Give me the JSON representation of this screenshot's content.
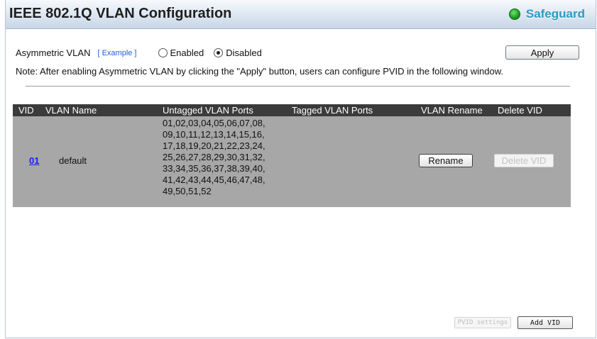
{
  "header": {
    "title": "IEEE 802.1Q VLAN Configuration",
    "safeguard_label": "Safeguard",
    "safeguard_color": "#2b9abf"
  },
  "asymmetric": {
    "label": "Asymmetric VLAN",
    "example_link": "[ Example ]",
    "options": [
      {
        "label": "Enabled",
        "checked": false
      },
      {
        "label": "Disabled",
        "checked": true
      }
    ],
    "apply_label": "Apply"
  },
  "note": "Note: After enabling Asymmetric VLAN by clicking the \"Apply\" button, users can configure PVID in the following window.",
  "table": {
    "columns": [
      "VID",
      "VLAN Name",
      "Untagged VLAN Ports",
      "Tagged VLAN Ports",
      "VLAN Rename",
      "Delete VID"
    ],
    "rows": [
      {
        "vid": "01",
        "name": "default",
        "untagged_lines": [
          "01,02,03,04,05,06,07,08,",
          "09,10,11,12,13,14,15,16,",
          "17,18,19,20,21,22,23,24,",
          "25,26,27,28,29,30,31,32,",
          "33,34,35,36,37,38,39,40,",
          "41,42,43,44,45,46,47,48,",
          "49,50,51,52"
        ],
        "tagged": "",
        "rename_label": "Rename",
        "delete_label": "Delete VID"
      }
    ]
  },
  "footer": {
    "pvid_settings_label": "PVID settings",
    "add_vid_label": "Add VID"
  }
}
